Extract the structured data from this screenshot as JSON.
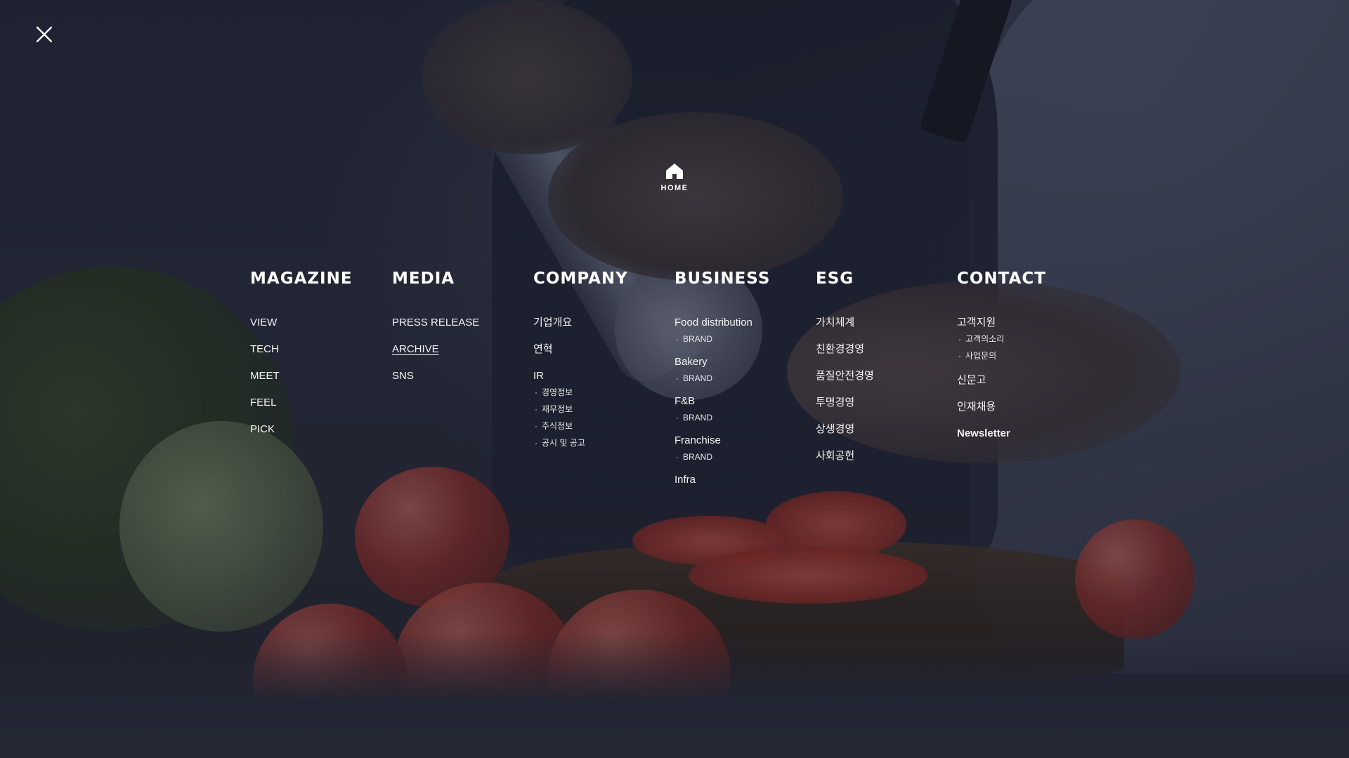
{
  "close": {
    "icon": "close-icon"
  },
  "home": {
    "label": "HOME",
    "icon": "home-icon"
  },
  "menu": {
    "magazine": {
      "title": "MAGAZINE",
      "items": [
        "VIEW",
        "TECH",
        "MEET",
        "FEEL",
        "PICK"
      ]
    },
    "media": {
      "title": "MEDIA",
      "items": [
        "PRESS RELEASE",
        "ARCHIVE",
        "SNS"
      ]
    },
    "company": {
      "title": "COMPANY",
      "items": [
        "기업개요",
        "연혁",
        "IR"
      ],
      "ir_sub": [
        "경영정보",
        "재무정보",
        "주식정보",
        "공시 및 공고"
      ]
    },
    "business": {
      "title": "BUSINESS",
      "items": [
        "Food distribution",
        "Bakery",
        "F&B",
        "Franchise",
        "Infra"
      ],
      "sub_label": "BRAND"
    },
    "esg": {
      "title": "ESG",
      "items": [
        "가치체계",
        "친환경경영",
        "품질안전경영",
        "투명경영",
        "상생경영",
        "사회공헌"
      ]
    },
    "contact": {
      "title": "CONTACT",
      "items": [
        "고객지원",
        "신문고",
        "인재채용",
        "Newsletter"
      ],
      "support_sub": [
        "고객의소리",
        "사업문의"
      ]
    }
  }
}
